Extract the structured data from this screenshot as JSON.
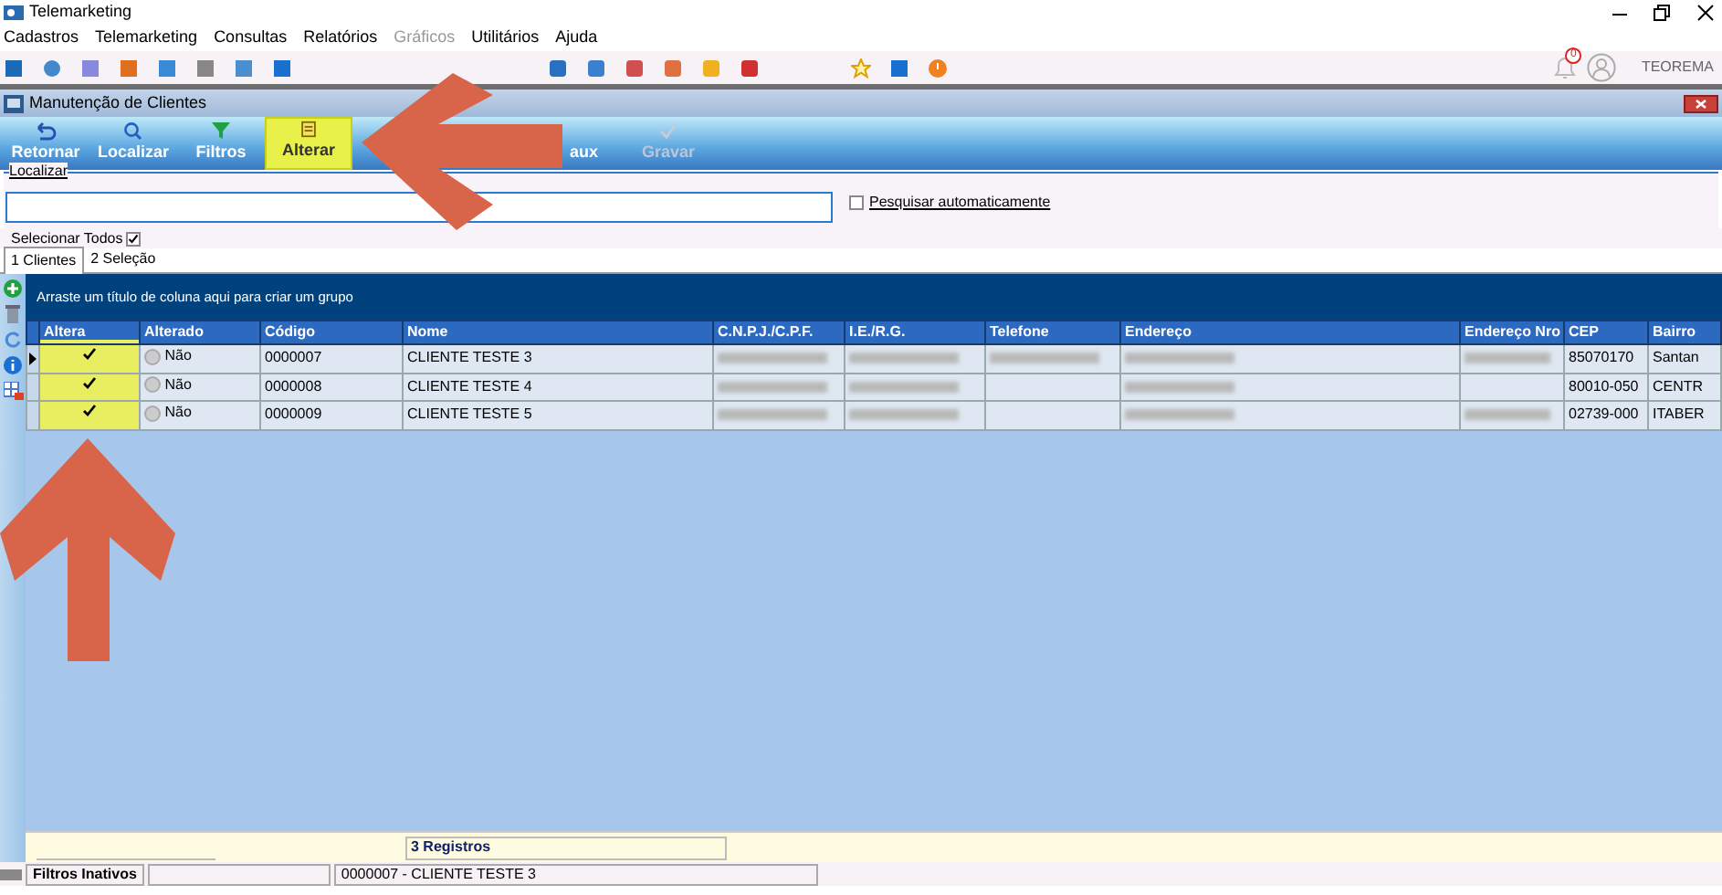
{
  "window": {
    "title": "Telemarketing"
  },
  "menu": [
    {
      "label": "Cadastros",
      "disabled": false
    },
    {
      "label": "Telemarketing",
      "disabled": false
    },
    {
      "label": "Consultas",
      "disabled": false
    },
    {
      "label": "Relatórios",
      "disabled": false
    },
    {
      "label": "Gráficos",
      "disabled": true
    },
    {
      "label": "Utilitários",
      "disabled": false
    },
    {
      "label": "Ajuda",
      "disabled": false
    }
  ],
  "notifications": {
    "count": "0"
  },
  "user": "TEOREMA",
  "child_window": {
    "title": "Manutenção de Clientes"
  },
  "toolbar": [
    {
      "label": "Retornar",
      "highlighted": false,
      "disabled": false
    },
    {
      "label": "Localizar",
      "highlighted": false,
      "disabled": false
    },
    {
      "label": "Filtros",
      "highlighted": false,
      "disabled": false
    },
    {
      "label": "Alterar",
      "highlighted": true,
      "disabled": false
    },
    {
      "label": "aux",
      "highlighted": false,
      "disabled": false
    },
    {
      "label": "Gravar",
      "highlighted": false,
      "disabled": true
    }
  ],
  "search": {
    "legend": "Localizar",
    "auto_search": {
      "label": "Pesquisar automaticamente",
      "checked": false
    }
  },
  "select_all": {
    "label": "Selecionar Todos",
    "checked": true
  },
  "tabs": [
    {
      "label": "1 Clientes",
      "selected": true
    },
    {
      "label": "2 Seleção",
      "selected": false
    }
  ],
  "grid": {
    "group_hint": "Arraste um título de coluna aqui para criar um grupo",
    "columns": [
      {
        "label": "Altera",
        "highlighted": true
      },
      {
        "label": "Alterado",
        "highlighted": false
      },
      {
        "label": "Código",
        "highlighted": false
      },
      {
        "label": "Nome",
        "highlighted": false
      },
      {
        "label": "C.N.P.J./C.P.F.",
        "highlighted": false
      },
      {
        "label": "I.E./R.G.",
        "highlighted": false
      },
      {
        "label": "Telefone",
        "highlighted": false
      },
      {
        "label": "Endereço",
        "highlighted": false
      },
      {
        "label": "Endereço Nro",
        "highlighted": false
      },
      {
        "label": "CEP",
        "highlighted": false
      },
      {
        "label": "Bairro",
        "highlighted": false
      }
    ],
    "rows": [
      {
        "current": true,
        "altera": true,
        "alterado": "Não",
        "cells": [
          {
            "text": "0000007"
          },
          {
            "text": "CLIENTE TESTE 3"
          },
          {
            "blurred": true
          },
          {
            "blurred": true
          },
          {
            "blurred": true
          },
          {
            "blurred": true
          },
          {
            "blurred": true
          },
          {
            "text": "85070170"
          },
          {
            "text": "Santan"
          }
        ]
      },
      {
        "current": false,
        "altera": true,
        "alterado": "Não",
        "cells": [
          {
            "text": "0000008"
          },
          {
            "text": "CLIENTE TESTE 4"
          },
          {
            "blurred": true
          },
          {
            "blurred": true
          },
          null,
          {
            "blurred": true
          },
          null,
          {
            "text": "80010-050"
          },
          {
            "text": "CENTR"
          }
        ]
      },
      {
        "current": false,
        "altera": true,
        "alterado": "Não",
        "cells": [
          {
            "text": "0000009"
          },
          {
            "text": "CLIENTE TESTE 5"
          },
          {
            "blurred": true
          },
          {
            "blurred": true
          },
          null,
          {
            "blurred": true
          },
          {
            "blurred": true
          },
          {
            "text": "02739-000"
          },
          {
            "text": "ITABER"
          }
        ]
      }
    ],
    "footer": "3 Registros"
  },
  "status_bar": [
    "Filtros Inativos",
    "0000007 - CLIENTE TESTE 3"
  ]
}
